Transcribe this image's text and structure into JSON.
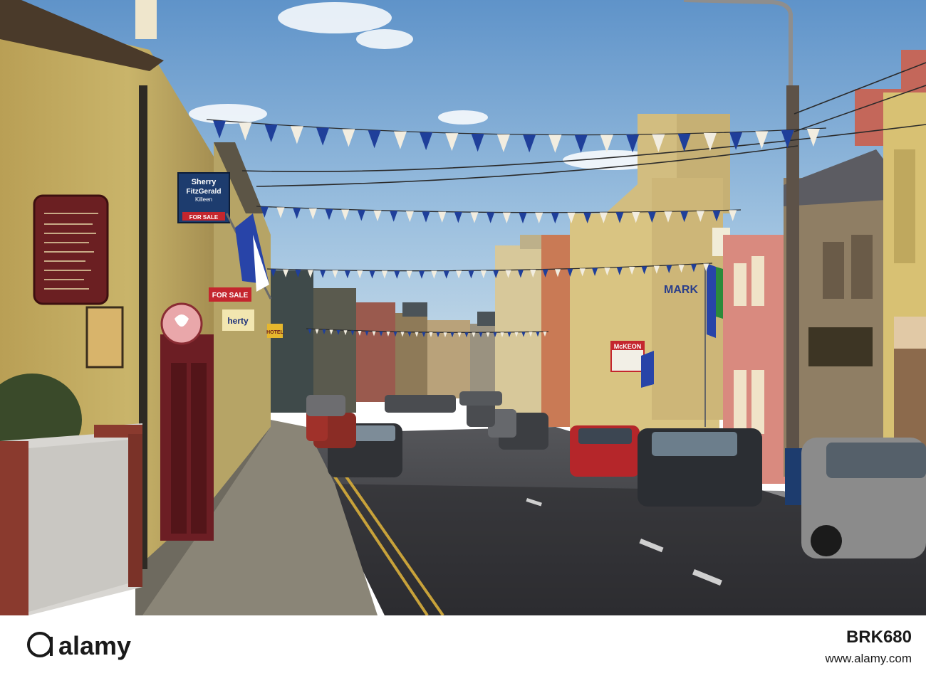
{
  "photo": {
    "signs": {
      "agent_line1": "Sherry",
      "agent_line2": "FitzGerald",
      "agent_line3": "Killeen",
      "for_sale_a": "FOR SALE",
      "for_sale_b": "FOR SALE",
      "herty": "herty",
      "market": "MARK",
      "mckeon": "McKEON",
      "hotel": "HOTEL"
    }
  },
  "watermark": {
    "brand": "alamy",
    "stock_id": "BRK680",
    "url": "www.alamy.com"
  },
  "colors": {
    "sky": "#8fb6db",
    "bunting_blue": "#1f3f9a",
    "bunting_white": "#f2ede0",
    "road": "#3b3b3f",
    "yellow_building": "#c9b46a"
  }
}
